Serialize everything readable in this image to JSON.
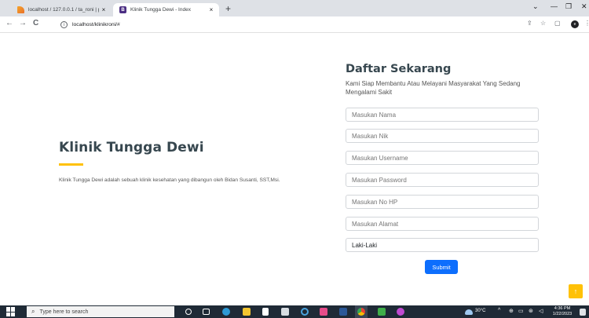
{
  "browser": {
    "tabs": [
      {
        "title": "localhost / 127.0.0.1 / ta_roni | ph",
        "close": "×"
      },
      {
        "title": "Klinik Tungga Dewi - Index",
        "close": "×"
      }
    ],
    "new_tab": "+",
    "window_controls": {
      "dropdown": "⌄",
      "minimize": "—",
      "maximize": "❐",
      "close": "✕"
    },
    "nav": {
      "back": "←",
      "forward": "→",
      "reload": "C"
    },
    "url": "localhost/klinikroni/#",
    "profile_initial": "e"
  },
  "hero": {
    "title": "Klinik Tungga Dewi",
    "description": "Klinik Tungga Dewi adalah sebuah klinik kesehatan yang dibangun oleh Bidan Susanti, SST,Msi."
  },
  "form": {
    "heading": "Daftar Sekarang",
    "subheading": "Kami Siap Membantu Atau Melayani Masyarakat Yang Sedang Mengalami Sakit",
    "placeholders": {
      "nama": "Masukan Nama",
      "nik": "Masukan Nik",
      "username": "Masukan Username",
      "password": "Masukan Password",
      "nohp": "Masukan No HP",
      "alamat": "Masukan Alamat"
    },
    "gender_selected": "Laki-Laki",
    "submit_label": "Submit"
  },
  "back_to_top": "↑",
  "taskbar": {
    "search_placeholder": "Type here to search",
    "weather": "30°C",
    "time": "4:36 PM",
    "date": "1/22/2023"
  }
}
